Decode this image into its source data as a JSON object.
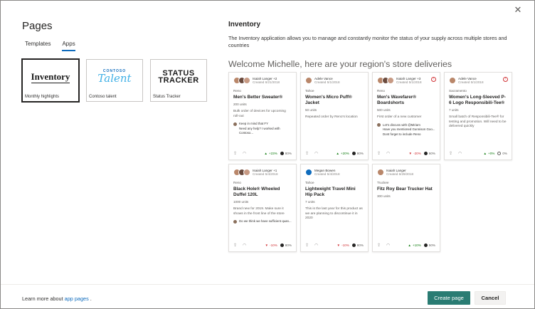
{
  "dialog": {
    "close_glyph": "✕"
  },
  "pages": {
    "title": "Pages",
    "tabs": [
      {
        "label": "Templates",
        "active": false
      },
      {
        "label": "Apps",
        "active": true
      }
    ],
    "tiles": [
      {
        "logo_text": "Inventory",
        "caption": "Monthly highlights",
        "selected": true
      },
      {
        "logo_top": "CONTOSO",
        "logo_main": "Talent",
        "caption": "Contoso talent",
        "selected": false
      },
      {
        "logo_line1": "STATUS",
        "logo_line2": "TRACKER",
        "caption": "Status Tracker",
        "selected": false
      }
    ]
  },
  "detail": {
    "title": "Inventory",
    "description": "The Inventory application allows you to manage and constantly monitor the status of your supply across multiple stores and countries",
    "welcome": "Welcome Michelle, here are your region's store deliveries"
  },
  "cards": [
    {
      "author": "Isaiah Langer +2",
      "date": "Created 6/21/2018",
      "location": "Reno",
      "name": "Men's Better Sweater®",
      "units": "200 units",
      "desc": "Bulk order of devices for upcoming roll-out",
      "alert": false,
      "comments": [
        "Keep in mind that FY",
        "Need any help? I worked with Contoso..."
      ],
      "trend": "+23%",
      "trend_dir": "up",
      "fill": "80%"
    },
    {
      "author": "Adele Vance",
      "date": "Created 5/1/2018",
      "location": "Tahoe",
      "name": "Women's Micro Puff® Jacket",
      "units": "50 units",
      "desc": "Repeated order by Reno's location",
      "alert": false,
      "comments": [],
      "trend": "+20%",
      "trend_dir": "up",
      "fill": "80%"
    },
    {
      "author": "Isaiah Langer +3",
      "date": "Created 5/1/2018",
      "location": "Reno",
      "name": "Men's Wavefarer® Boardshorts",
      "units": "500 units",
      "desc": "First order of a new customer",
      "alert": true,
      "comments": [
        "Let's discuss with @Miriam",
        "Have you mentioned Gunnison Goo...",
        "Dont forget to include Reno"
      ],
      "trend": "-20%",
      "trend_dir": "down",
      "fill": "60%"
    },
    {
      "author": "Adele Vance",
      "date": "Created 5/1/2018",
      "location": "Sacramento",
      "name": "Women's Long-Sleeved P-6 Logo Responsibili-Tee®",
      "units": "7 units",
      "desc": "Small batch of Responsibili-Tee® for testing and promotion. Will need to be delivered quickly",
      "alert": true,
      "comments": [],
      "trend": "+0%",
      "trend_dir": "up",
      "fill": "0%"
    },
    {
      "author": "Isaiah Langer +1",
      "date": "Created 5/4/2018",
      "location": "Reno",
      "name": "Black Hole® Wheeled Duffel 120L",
      "units": "1000 units",
      "desc": "Brand new for 2019. Make sure it shows in the front line of the store",
      "alert": false,
      "comments": [
        "Do we think we have sufficient quan..."
      ],
      "trend": "-10%",
      "trend_dir": "down",
      "fill": "80%"
    },
    {
      "author": "Megan Bowen",
      "date": "Created 5/4/2018",
      "location": "Tahoe",
      "name": "Lightweight Travel Mini Hip Pack",
      "units": "7 units",
      "desc": "This is the last year for this product as we are planning to discontinue it in 2020",
      "alert": false,
      "comments": [],
      "trend": "-10%",
      "trend_dir": "down",
      "fill": "80%"
    },
    {
      "author": "Isaiah Langer",
      "date": "Created 6/29/2018",
      "location": "Truckee",
      "name": "Fitz Roy Bear Trucker Hat",
      "units": "300 units",
      "desc": "",
      "alert": false,
      "comments": [],
      "trend": "+10%",
      "trend_dir": "up",
      "fill": "50%"
    }
  ],
  "footer": {
    "learn_prefix": "Learn more about ",
    "learn_link": "app pages",
    "learn_suffix": ".",
    "create": "Create page",
    "cancel": "Cancel"
  },
  "colors": {
    "accent": "#0f6cbd",
    "primary_button": "#2a7c73",
    "up": "#107c10",
    "down": "#d13438"
  }
}
